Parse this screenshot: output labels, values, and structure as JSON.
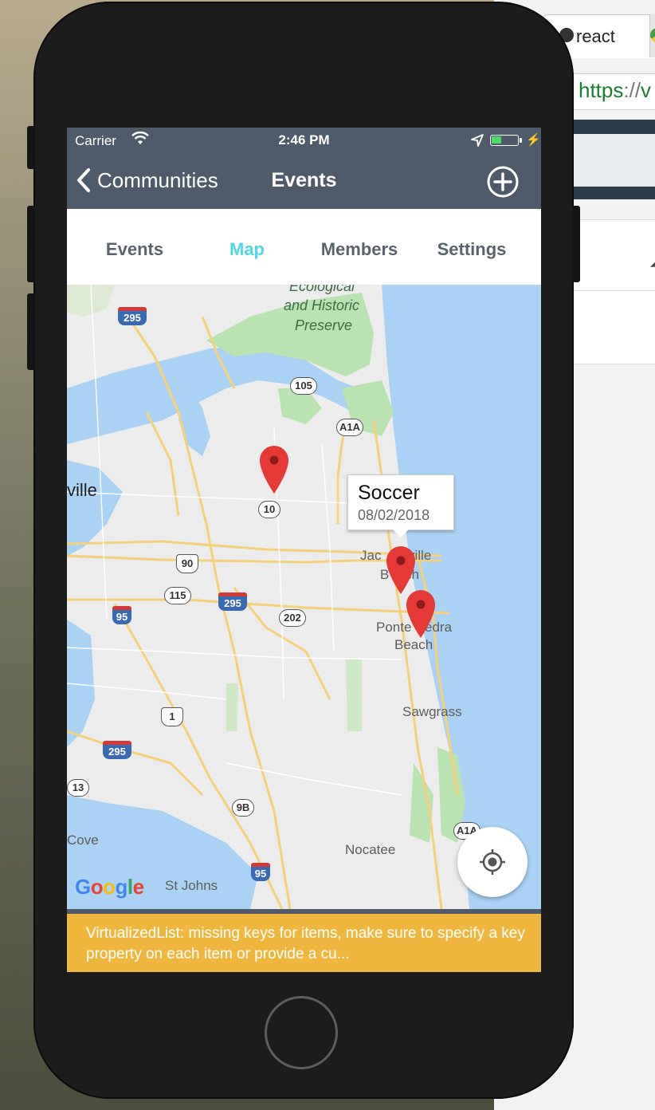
{
  "browser": {
    "tab_label": "react",
    "url_prefix": "https",
    "url_sep": "://",
    "url_tail": "v"
  },
  "status": {
    "carrier": "Carrier",
    "time": "2:46 PM",
    "battery_level": 0.4
  },
  "navbar": {
    "back_label": "Communities",
    "title": "Events"
  },
  "tabs": [
    {
      "label": "Events",
      "active": false
    },
    {
      "label": "Map",
      "active": true
    },
    {
      "label": "Members",
      "active": false
    },
    {
      "label": "Settings",
      "active": false
    }
  ],
  "map": {
    "labels": {
      "preserve_line1": "Ecological",
      "preserve_line2": "and Historic",
      "preserve_line3": "Preserve",
      "jacksonville": "ville",
      "jax_beach_1": "Jac",
      "jax_beach_2": "ville",
      "jax_beach_3": "B",
      "jax_beach_4": "ch",
      "ponte_1": "Ponte",
      "ponte_2": "edra",
      "ponte_3": "Beach",
      "sawgrass": "Sawgrass",
      "nocatee": "Nocatee",
      "st_johns": "St Johns",
      "cove": "Cove"
    },
    "shields": {
      "i295_top": "295",
      "i295_mid": "295",
      "i295_bottom": "295",
      "i95_mid": "95",
      "i95_bottom": "95",
      "sr105": "105",
      "a1a_top": "A1A",
      "a1a_bottom": "A1A",
      "sr10": "10",
      "us90": "90",
      "sr115": "115",
      "sr202": "202",
      "us1": "1",
      "sr13": "13",
      "sr9b": "9B"
    },
    "callout": {
      "title": "Soccer",
      "date": "08/02/2018"
    },
    "google_letters": [
      "G",
      "o",
      "o",
      "g",
      "l",
      "e"
    ],
    "colors": {
      "water": "#a9d2f5",
      "land": "#ececec",
      "park": "#b9e3b0",
      "road": "#f5d27a",
      "pin": "#e53935"
    }
  },
  "warning": {
    "text": "VirtualizedList: missing keys for items, make sure to specify a key property on each item or provide a cu..."
  },
  "colors": {
    "header": "#4f5b6b",
    "tab_active": "#4fd8e8",
    "tab_inactive": "#59636e",
    "warning_bg": "#f0b73e"
  }
}
